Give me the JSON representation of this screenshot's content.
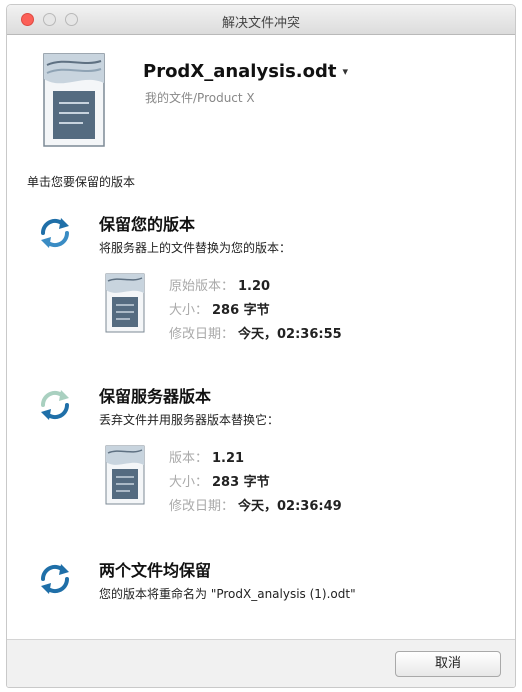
{
  "window": {
    "title": "解决文件冲突"
  },
  "header": {
    "filename": "ProdX_analysis.odt",
    "caret": "▾",
    "path": "我的文件/Product X"
  },
  "instruction": "单击您要保留的版本",
  "options": [
    {
      "title": "保留您的版本",
      "desc": "将服务器上的文件替换为您的版本：",
      "icon": "sync-arrows-icon",
      "meta": [
        {
          "label": "原始版本：",
          "value": "1.20"
        },
        {
          "label": "大小：",
          "value": "286 字节"
        },
        {
          "label": "修改日期：",
          "value": "今天，02:36:55"
        }
      ]
    },
    {
      "title": "保留服务器版本",
      "desc": "丢弃文件并用服务器版本替换它：",
      "icon": "sync-arrows-icon",
      "meta": [
        {
          "label": "版本：",
          "value": "1.21"
        },
        {
          "label": "大小：",
          "value": "283 字节"
        },
        {
          "label": "修改日期：",
          "value": "今天，02:36:49"
        }
      ]
    },
    {
      "title": "两个文件均保留",
      "desc": "您的版本将重命名为 \"ProdX_analysis (1).odt\"",
      "icon": "sync-arrows-icon"
    }
  ],
  "footer": {
    "cancel_label": "取消"
  },
  "colors": {
    "sync_icon": "#1f6fa8",
    "sync_icon_faded": "#a9d0c0",
    "close_light": "#fc6058"
  }
}
